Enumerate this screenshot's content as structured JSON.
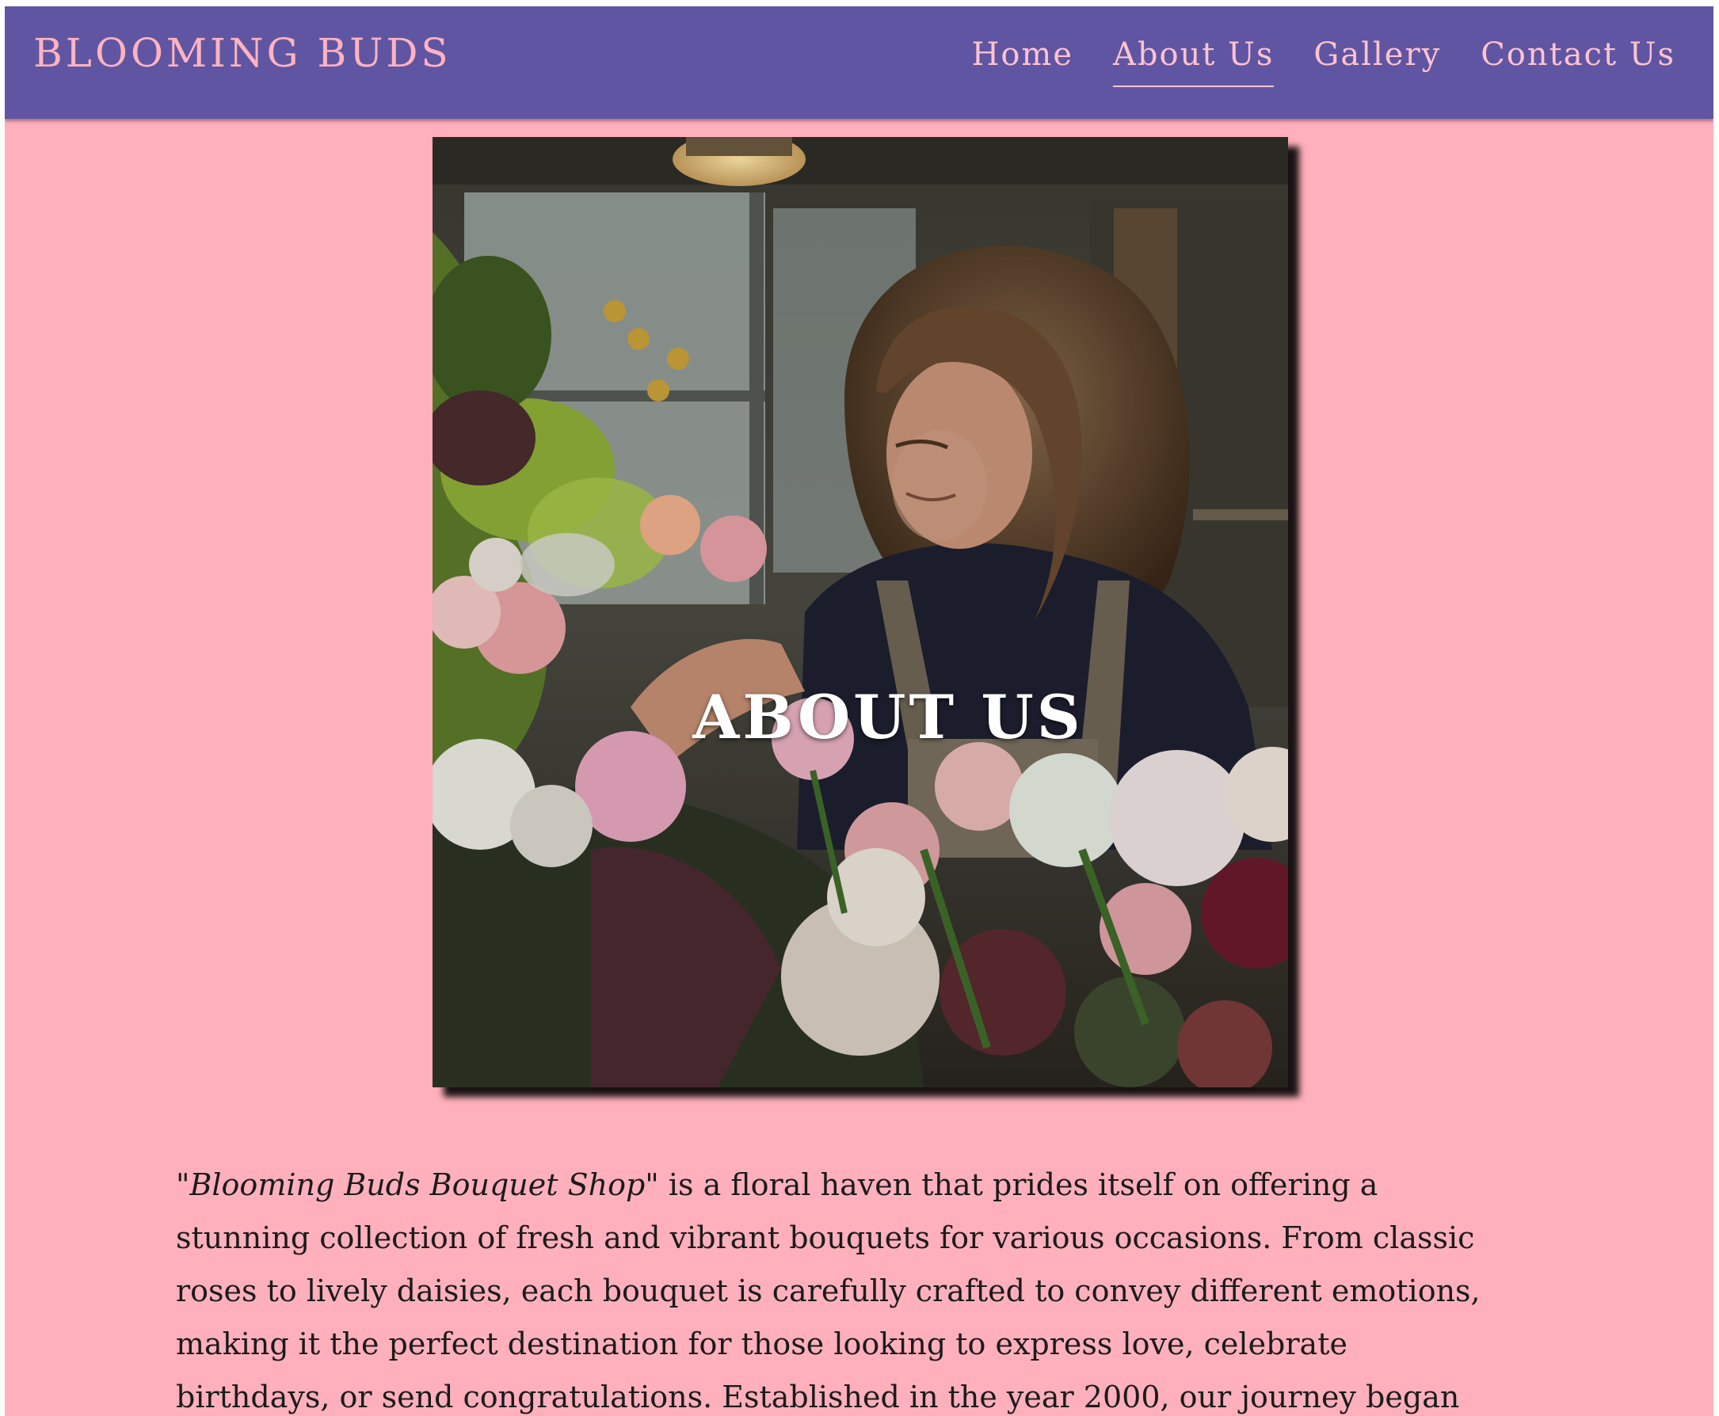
{
  "brand": {
    "name": "BLOOMING BUDS"
  },
  "nav": {
    "items": [
      {
        "label": "Home",
        "active": false
      },
      {
        "label": "About Us",
        "active": true
      },
      {
        "label": "Gallery",
        "active": false
      },
      {
        "label": "Contact Us",
        "active": false
      }
    ]
  },
  "hero": {
    "title": "ABOUT US",
    "image": "florist-arranging-flowers-photo"
  },
  "about": {
    "shop_name": "\"Blooming Buds Bouquet Shop\"",
    "paragraph": " is a floral haven that prides itself on offering a stunning collection of fresh and vibrant bouquets for various occasions. From classic roses to lively daisies, each bouquet is carefully crafted to convey different emotions, making it the perfect destination for those looking to express love, celebrate birthdays, or send congratulations. Established in the year 2000, our journey began with a profound passion for transforming"
  },
  "colors": {
    "background": "#ffb0bc",
    "navbar": "#6055a2",
    "nav_text": "#ffc3cf",
    "brand_text": "#ffb3c0"
  }
}
